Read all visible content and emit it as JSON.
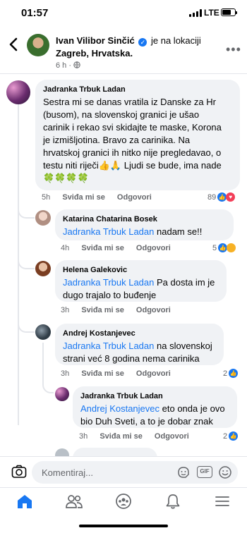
{
  "status_bar": {
    "time": "01:57",
    "network": "LTE",
    "battery_level": 0.7
  },
  "post_header": {
    "author": "Ivan Vilibor Sinčić",
    "location_text": "je na lokaciji",
    "location": "Zagreb, Hrvatska.",
    "meta": "6 h ·"
  },
  "comments": [
    {
      "author": "Jadranka Trbuk Ladan",
      "text_lines": [
        "Sestra mi se danas vratila iz Danske za Hr",
        "(busom), na slovenskoj granici je ušao",
        "carinik i rekao svi skidajte te maske, Korona",
        "je izmišljotina. Bravo za carinika. Na",
        "hrvatskoj granici ih nitko nije pregledavao, o",
        "testu niti riječi👍🙏 Ljudi se bude, ima nade",
        "🍀🍀🍀🍀"
      ],
      "time": "5h",
      "like_label": "Sviđa mi se",
      "reply_label": "Odgovori",
      "reaction_count": "89"
    },
    {
      "author": "Katarina Chatarina Bosek",
      "mention": "Jadranka Trbuk Ladan",
      "text": "nadam se!!",
      "time": "4h",
      "like_label": "Sviđa mi se",
      "reply_label": "Odgovori",
      "reaction_count": "5"
    },
    {
      "author": "Helena Galekovic",
      "mention": "Jadranka Trbuk Ladan",
      "text": "Pa dosta im je",
      "text_line2": "dugo trajalo to buđenje",
      "time": "3h",
      "like_label": "Sviđa mi se",
      "reply_label": "Odgovori"
    },
    {
      "author": "Andrej Kostanjevec",
      "mention": "Jadranka Trbuk Ladan",
      "text": "na slovenskoj",
      "text_line2": "strani već 8 godina nema carinika",
      "time": "3h",
      "like_label": "Sviđa mi se",
      "reply_label": "Odgovori",
      "reaction_count": "2"
    },
    {
      "author": "Jadranka Trbuk Ladan",
      "mention": "Andrej Kostanjevec",
      "text": "eto onda je ovo",
      "text_line2": "bio Duh Sveti, a to je dobar znak",
      "time": "3h",
      "like_label": "Sviđa mi se",
      "reply_label": "Odgovori",
      "reaction_count": "2"
    }
  ],
  "composer": {
    "placeholder": "Komentiraj...",
    "gif_label": "GIF"
  },
  "colors": {
    "accent": "#1877f2",
    "bubble": "#f0f2f5",
    "muted": "#65676b"
  }
}
